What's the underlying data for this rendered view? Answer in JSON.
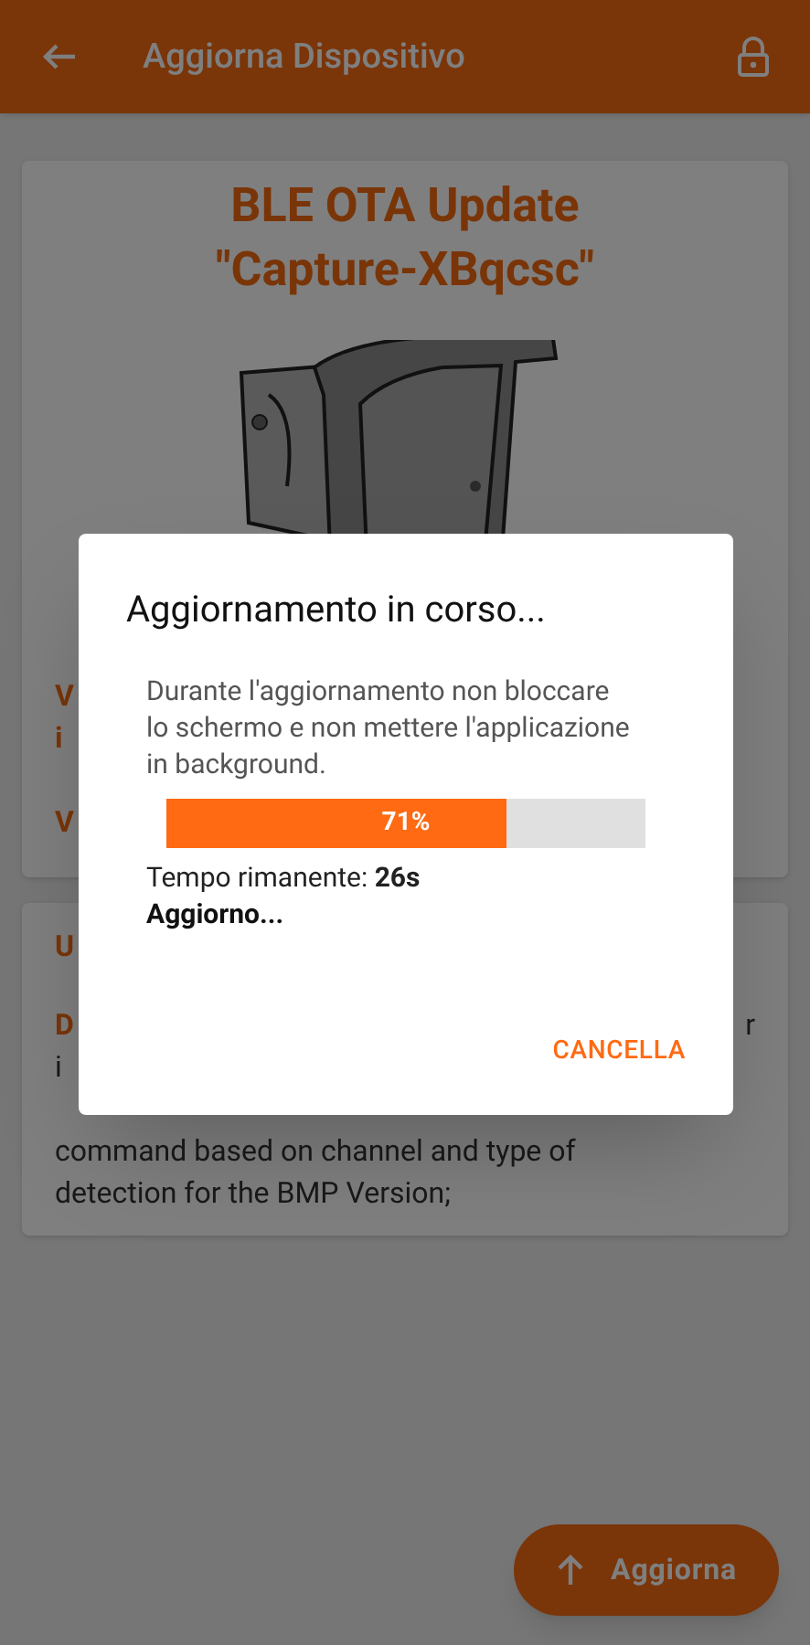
{
  "app_bar": {
    "title": "Aggiorna Dispositivo"
  },
  "device_card": {
    "title": "BLE OTA Update",
    "subtitle": "\"Capture-XBqcsc\"",
    "fields": [
      "V",
      "i",
      "V"
    ]
  },
  "release_card": {
    "heading": "U",
    "label": "D",
    "label_tail": "r",
    "text_lines": [
      "i",
      "command based on channel and type of",
      "detection for the BMP Version;"
    ]
  },
  "dialog": {
    "title": "Aggiornamento in corso...",
    "message": "Durante l'aggiornamento non bloccare lo schermo e non mettere l'applicazione in background.",
    "progress": {
      "level": 0.71,
      "label": "71%"
    },
    "remaining": "Tempo rimanente: **26s**",
    "status": "Aggiorno...",
    "cancel": "CANCELLA"
  },
  "fab": {
    "label": "Aggiorna"
  }
}
